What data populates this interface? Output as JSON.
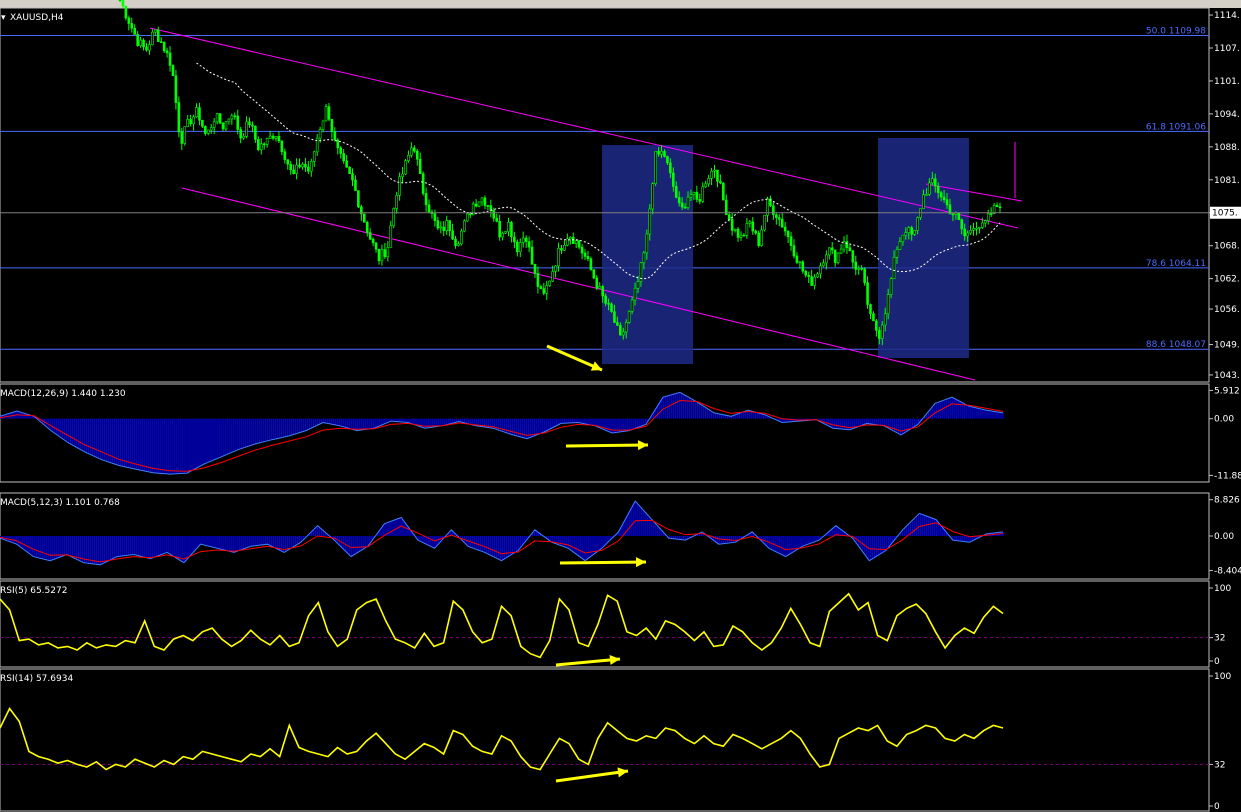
{
  "window": {
    "title": "XAUUSD,H4"
  },
  "colors": {
    "background": "#000000",
    "candle_up": "#00ff00",
    "ma": "#ffffff",
    "channel": "#ff00ff",
    "fib": "#4d6bff",
    "box": "#1f2a8a",
    "macd_hist": "#0000ff",
    "signal": "#ff0000",
    "rsi": "#ffff00",
    "arrow": "#ffff00"
  },
  "chart_data": [
    {
      "type": "candlestick",
      "symbol_label": "XAUUSD,H4",
      "ylim": [
        1042,
        1115
      ],
      "yticks": [
        "1114.",
        "1107.",
        "1101.",
        "1094.",
        "1088.",
        "1081.",
        "1075.",
        "1068.",
        "1062.",
        "1056.",
        "1049.",
        "1043."
      ],
      "ytick_values": [
        1114,
        1107.5,
        1101,
        1094.5,
        1088,
        1081.5,
        1075,
        1068.5,
        1062,
        1056,
        1049,
        1043
      ],
      "current_price_label": "1075.",
      "fib_levels": [
        {
          "label": "50.0 1109.98",
          "value": 1109.98
        },
        {
          "label": "61.8 1091.06",
          "value": 1091.06
        },
        {
          "label": "78.6 1064.11",
          "value": 1064.11
        },
        {
          "label": "88.6 1048.07",
          "value": 1048.07
        }
      ],
      "close_path": [
        1117,
        1113,
        1109,
        1107,
        1111,
        1108,
        1104,
        1089,
        1093,
        1095,
        1090,
        1094,
        1092,
        1095,
        1090,
        1093,
        1088,
        1089,
        1091,
        1087,
        1082,
        1085,
        1083,
        1091,
        1096,
        1088,
        1084,
        1081,
        1075,
        1070,
        1066,
        1068,
        1079,
        1084,
        1089,
        1080,
        1075,
        1071,
        1073,
        1069,
        1073,
        1077,
        1078,
        1076,
        1071,
        1073,
        1068,
        1071,
        1063,
        1058,
        1063,
        1068,
        1071,
        1069,
        1066,
        1062,
        1058,
        1055,
        1050,
        1055,
        1061,
        1069,
        1086,
        1087,
        1081,
        1075,
        1079,
        1077,
        1082,
        1084,
        1077,
        1072,
        1070,
        1073,
        1069,
        1077,
        1075,
        1072,
        1068,
        1064,
        1061,
        1064,
        1068,
        1066,
        1070,
        1065,
        1063,
        1054,
        1051,
        1058,
        1068,
        1072,
        1070,
        1078,
        1081,
        1079,
        1076,
        1074,
        1070,
        1073,
        1072,
        1075,
        1077
      ],
      "series": [
        {
          "name": "MA",
          "style": "dashed"
        }
      ]
    },
    {
      "type": "macd",
      "label": "MACD(12,26,9) 1.440 1.230",
      "ylim": [
        -12,
        6
      ],
      "yticks": [
        "5.912",
        "0.00",
        "-11.88"
      ],
      "ytick_values": [
        5.912,
        0,
        -11.88
      ],
      "values": [
        0.5,
        1.6,
        0.5,
        -2.5,
        -5.0,
        -7.0,
        -8.6,
        -9.8,
        -10.6,
        -11.3,
        -11.6,
        -11.4,
        -9.5,
        -8.0,
        -6.5,
        -5.3,
        -4.4,
        -3.6,
        -2.5,
        -0.8,
        -1.5,
        -2.5,
        -2.0,
        -0.5,
        -0.8,
        -2.0,
        -1.5,
        -0.6,
        -1.5,
        -2.0,
        -3.2,
        -4.2,
        -2.8,
        -1.0,
        -0.8,
        -1.5,
        -3.0,
        -2.5,
        -1.2,
        4.5,
        5.5,
        3.5,
        1.2,
        0.5,
        1.8,
        0.8,
        -0.8,
        -0.5,
        -0.2,
        -2.0,
        -2.3,
        -1.0,
        -1.5,
        -3.4,
        -1.2,
        3.2,
        4.5,
        2.6,
        1.8,
        1.2
      ],
      "signal": [
        0.2,
        0.8,
        0.6,
        -1.5,
        -3.5,
        -5.5,
        -7.0,
        -8.5,
        -9.5,
        -10.4,
        -10.9,
        -11.0,
        -10.3,
        -9.2,
        -7.9,
        -6.6,
        -5.6,
        -4.7,
        -3.8,
        -2.4,
        -2.0,
        -2.2,
        -2.1,
        -1.2,
        -1.0,
        -1.6,
        -1.5,
        -0.9,
        -1.3,
        -1.7,
        -2.6,
        -3.5,
        -3.0,
        -1.8,
        -1.2,
        -1.4,
        -2.4,
        -2.4,
        -1.6,
        2.0,
        3.8,
        3.6,
        2.1,
        1.1,
        1.5,
        1.1,
        0.0,
        -0.3,
        -0.2,
        -1.3,
        -1.9,
        -1.3,
        -1.4,
        -2.6,
        -1.7,
        1.2,
        3.1,
        2.8,
        2.2,
        1.5
      ],
      "arrow_annotation": "yellow"
    },
    {
      "type": "macd",
      "label": "MACD(5,12,3) 1.101 0.768",
      "ylim": [
        -9,
        9
      ],
      "yticks": [
        "8.826",
        "0.00",
        "-8.404"
      ],
      "ytick_values": [
        8.826,
        0,
        -8.404
      ],
      "values": [
        -0.5,
        -2.0,
        -5.0,
        -6.0,
        -4.5,
        -6.5,
        -7.0,
        -5.0,
        -4.5,
        -5.5,
        -4.0,
        -6.5,
        -2.0,
        -3.0,
        -4.0,
        -2.5,
        -2.0,
        -4.0,
        -1.5,
        2.5,
        -1.0,
        -5.0,
        -2.5,
        3.0,
        4.5,
        -1.0,
        -3.0,
        1.5,
        -2.5,
        -4.0,
        -6.0,
        -3.5,
        1.5,
        -1.5,
        -3.0,
        -6.0,
        -3.0,
        1.0,
        8.5,
        4.0,
        -0.5,
        -1.0,
        1.0,
        -2.0,
        -1.5,
        1.0,
        -3.0,
        -5.0,
        -2.5,
        -1.0,
        2.5,
        -0.5,
        -6.0,
        -3.5,
        1.5,
        5.5,
        4.0,
        -1.0,
        -1.5,
        0.5,
        1.0
      ],
      "signal": [
        -0.3,
        -1.2,
        -3.2,
        -4.7,
        -4.6,
        -5.6,
        -6.3,
        -5.6,
        -5.0,
        -5.3,
        -4.6,
        -5.6,
        -3.8,
        -3.4,
        -3.7,
        -3.1,
        -2.5,
        -3.3,
        -2.4,
        0.0,
        -0.5,
        -2.8,
        -2.6,
        0.2,
        2.4,
        0.7,
        -1.2,
        0.2,
        -1.2,
        -2.6,
        -4.3,
        -3.9,
        -1.2,
        -1.4,
        -2.2,
        -4.1,
        -3.5,
        -1.2,
        3.7,
        3.8,
        1.6,
        0.3,
        0.6,
        -0.7,
        -1.1,
        -0.1,
        -1.5,
        -3.3,
        -2.9,
        -1.9,
        0.3,
        -0.1,
        -3.1,
        -3.3,
        -0.9,
        2.3,
        3.2,
        1.1,
        -0.2,
        0.2,
        0.6
      ],
      "arrow_annotation": "yellow"
    },
    {
      "type": "line",
      "label": "RSI(5) 65.5272",
      "ylim": [
        0,
        100
      ],
      "yticks": [
        "100",
        "32",
        "0"
      ],
      "ytick_values": [
        100,
        32,
        0
      ],
      "level_line": 32,
      "values": [
        85,
        70,
        28,
        30,
        22,
        25,
        18,
        20,
        15,
        25,
        18,
        22,
        20,
        28,
        25,
        55,
        20,
        15,
        30,
        35,
        28,
        40,
        45,
        30,
        20,
        28,
        42,
        30,
        22,
        35,
        20,
        25,
        62,
        80,
        40,
        20,
        30,
        70,
        80,
        85,
        55,
        30,
        25,
        18,
        38,
        20,
        25,
        82,
        70,
        40,
        25,
        30,
        75,
        62,
        20,
        10,
        5,
        28,
        85,
        70,
        25,
        20,
        50,
        90,
        82,
        40,
        35,
        45,
        30,
        55,
        50,
        40,
        28,
        40,
        20,
        22,
        48,
        40,
        25,
        15,
        25,
        45,
        72,
        50,
        25,
        20,
        68,
        80,
        92,
        70,
        80,
        35,
        28,
        62,
        72,
        78,
        65,
        40,
        18,
        35,
        45,
        38,
        60,
        75,
        65
      ],
      "arrow_annotation": "yellow"
    },
    {
      "type": "line",
      "label": "RSI(14) 57.6934",
      "ylim": [
        0,
        100
      ],
      "yticks": [
        "100",
        "32",
        "0"
      ],
      "ytick_values": [
        100,
        32,
        0
      ],
      "level_line": 32,
      "values": [
        60,
        75,
        65,
        42,
        38,
        36,
        33,
        35,
        32,
        30,
        34,
        28,
        32,
        30,
        36,
        33,
        30,
        35,
        32,
        38,
        36,
        42,
        40,
        38,
        36,
        34,
        40,
        38,
        44,
        38,
        62,
        45,
        42,
        40,
        38,
        45,
        40,
        42,
        50,
        56,
        48,
        40,
        36,
        42,
        48,
        45,
        40,
        58,
        55,
        46,
        42,
        40,
        54,
        50,
        38,
        30,
        28,
        40,
        52,
        48,
        36,
        32,
        52,
        64,
        58,
        52,
        50,
        54,
        52,
        60,
        58,
        52,
        48,
        54,
        48,
        46,
        55,
        52,
        48,
        44,
        48,
        52,
        58,
        52,
        40,
        30,
        32,
        52,
        56,
        60,
        58,
        62,
        50,
        46,
        55,
        58,
        62,
        60,
        52,
        50,
        55,
        52,
        58,
        62,
        60
      ],
      "arrow_annotation": "yellow"
    }
  ]
}
